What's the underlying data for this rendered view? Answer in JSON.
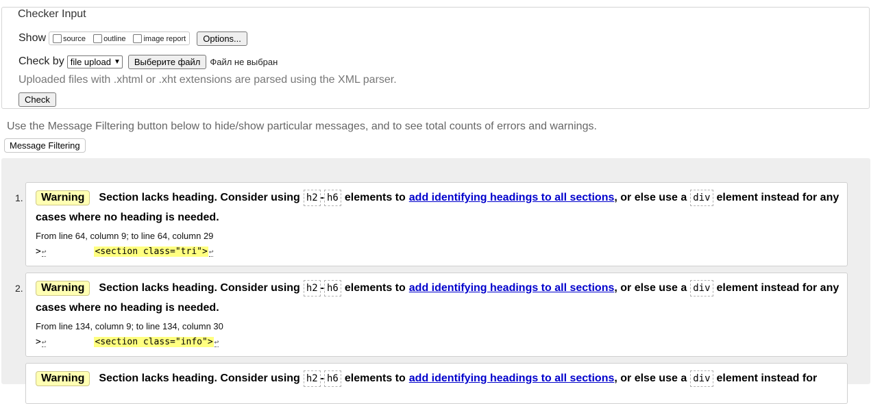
{
  "fieldset": {
    "legend": "Checker Input",
    "show_label": "Show",
    "show_options": [
      {
        "label": "source",
        "checked": false
      },
      {
        "label": "outline",
        "checked": false
      },
      {
        "label": "image report",
        "checked": false
      }
    ],
    "options_button": "Options...",
    "checkby_label": "Check by",
    "checkby_value": "file upload",
    "file_button": "Выберите файл",
    "file_status": "Файл не выбран",
    "note": "Uploaded files with .xhtml or .xht extensions are parsed using the XML parser.",
    "check_button": "Check"
  },
  "filter": {
    "text": "Use the Message Filtering button below to hide/show particular messages, and to see total counts of errors and warnings.",
    "button": "Message Filtering"
  },
  "messages": [
    {
      "num": "1.",
      "type": "Warning",
      "text_a": "Section lacks heading. Consider using",
      "code1": "h2",
      "dash": "-",
      "code2": "h6",
      "text_b": "elements to",
      "link": "add identifying headings to all sections",
      "text_c": ", or else use a",
      "code3": "div",
      "text_d": "element instead for any",
      "text_e": "cases where no heading is needed.",
      "location": "From line 64, column 9; to line 64, column 29",
      "extract_prefix": ">",
      "extract_code": "<section class=\"tri\">",
      "return_mark": "↩"
    },
    {
      "num": "2.",
      "type": "Warning",
      "text_a": "Section lacks heading. Consider using",
      "code1": "h2",
      "dash": "-",
      "code2": "h6",
      "text_b": "elements to",
      "link": "add identifying headings to all sections",
      "text_c": ", or else use a",
      "code3": "div",
      "text_d": "element instead for any",
      "text_e": "cases where no heading is needed.",
      "location": "From line 134, column 9; to line 134, column 30",
      "extract_prefix": ">",
      "extract_code": "<section class=\"info\">",
      "return_mark": "↩"
    },
    {
      "num": "",
      "type": "Warning",
      "text_a": "Section lacks heading. Consider using",
      "code1": "h2",
      "dash": "-",
      "code2": "h6",
      "text_b": "elements to",
      "link": "add identifying headings to all sections",
      "text_c": ", or else use a",
      "code3": "div",
      "text_d": "element instead for",
      "text_e": "",
      "location": "",
      "extract_prefix": "",
      "extract_code": "",
      "return_mark": ""
    }
  ]
}
